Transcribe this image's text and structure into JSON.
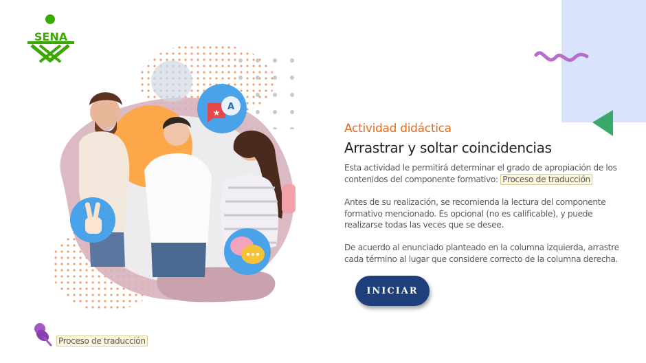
{
  "logo": {
    "text": "SENA",
    "color": "#39a900"
  },
  "activity": {
    "subtitle": "Actividad didáctica",
    "title": "Arrastrar y soltar coincidencias",
    "p1_text": "Esta actividad le permitirá determinar el grado de apropiación de los contenidos del componente formativo:",
    "component_name": "Proceso de traducción",
    "p2_text": "Antes de su realización, se recomienda la lectura del componente formativo mencionado.  Es opcional (no es calificable), y puede realizarse todas las veces que se desee.",
    "p3_text": "De acuerdo al enunciado planteado en la columna izquierda, arrastre cada término al lugar que considere correcto de la columna derecha."
  },
  "start_button": {
    "label": "INICIAR"
  },
  "footer": {
    "component_label": "Proceso de traducción"
  },
  "colors": {
    "accent_orange": "#e96a1c",
    "button_blue": "#1f3f7a",
    "panel_blue": "#d9e3fb",
    "wave_purple": "#b05ec8",
    "triangle_green": "#3aa86b",
    "icon_blue": "#4aa3e8"
  },
  "icons": [
    "translate-icon",
    "peace-hand-icon",
    "chat-bubbles-icon",
    "pushpin-icon"
  ]
}
